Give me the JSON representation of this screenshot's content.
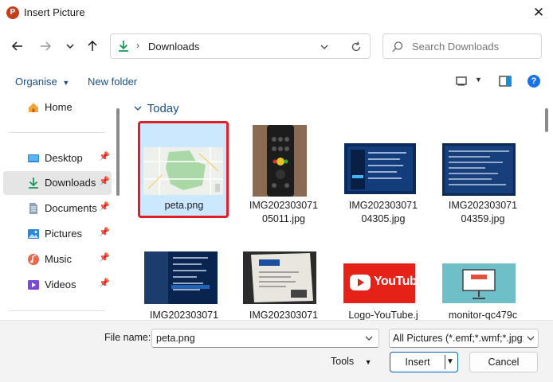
{
  "window": {
    "title": "Insert Picture",
    "app_icon_letter": "P"
  },
  "address": {
    "location": "Downloads"
  },
  "search": {
    "placeholder": "Search Downloads"
  },
  "toolbar": {
    "organise_label": "Organise",
    "new_folder_label": "New folder"
  },
  "sidebar": {
    "items": [
      {
        "label": "Home"
      },
      {
        "label": "Desktop"
      },
      {
        "label": "Downloads"
      },
      {
        "label": "Documents"
      },
      {
        "label": "Pictures"
      },
      {
        "label": "Music"
      },
      {
        "label": "Videos"
      }
    ]
  },
  "content": {
    "group_label": "Today",
    "files": [
      {
        "name_line1": "peta.png",
        "name_line2": ""
      },
      {
        "name_line1": "IMG202303071",
        "name_line2": "05011.jpg"
      },
      {
        "name_line1": "IMG202303071",
        "name_line2": "04305.jpg"
      },
      {
        "name_line1": "IMG202303071",
        "name_line2": "04359.jpg"
      },
      {
        "name_line1": "IMG202303071",
        "name_line2": ""
      },
      {
        "name_line1": "IMG202303071",
        "name_line2": ""
      },
      {
        "name_line1": "Logo-YouTube.j",
        "name_line2": ""
      },
      {
        "name_line1": "monitor-qc479c",
        "name_line2": ""
      }
    ],
    "youtube_text": "YouTube"
  },
  "footer": {
    "filename_label": "File name:",
    "filename_value": "peta.png",
    "filter_value": "All Pictures (*.emf;*.wmf;*.jpg;*",
    "tools_label": "Tools",
    "insert_label": "Insert",
    "cancel_label": "Cancel"
  },
  "colors": {
    "accent": "#0067c0",
    "selection": "#cce8ff",
    "highlight_border": "#e41c23",
    "youtube_red": "#e62117"
  }
}
